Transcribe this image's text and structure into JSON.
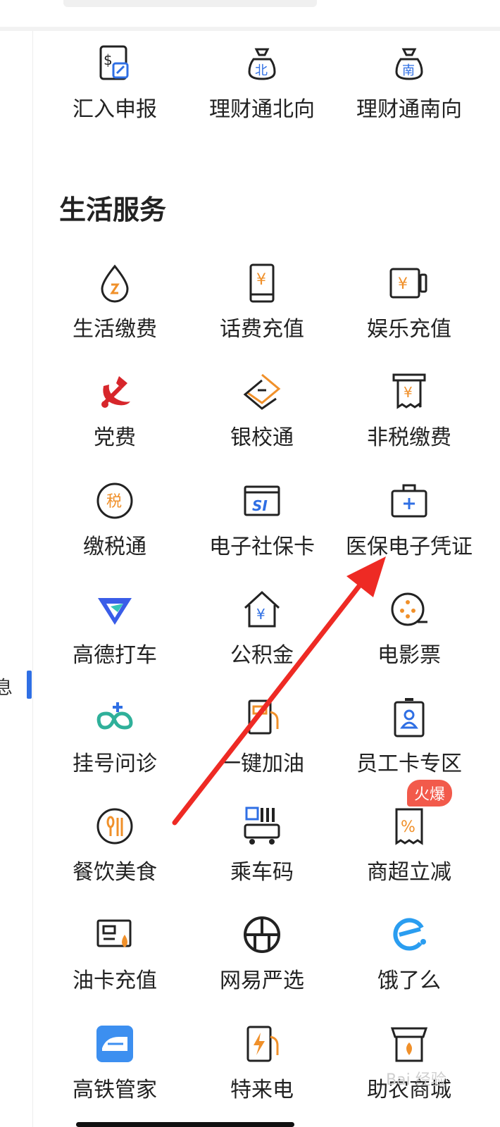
{
  "finance": {
    "items": [
      {
        "label": "汇入申报",
        "icon": "remittance-declare-icon"
      },
      {
        "label": "理财通北向",
        "icon": "northbound-moneybag-icon",
        "glyph": "北"
      },
      {
        "label": "理财通南向",
        "icon": "southbound-moneybag-icon",
        "glyph": "南"
      }
    ]
  },
  "sidebar": {
    "active_label": "息"
  },
  "life_services": {
    "title": "生活服务",
    "items": [
      {
        "label": "生活缴费",
        "icon": "utility-drop-icon"
      },
      {
        "label": "话费充值",
        "icon": "phone-topup-icon",
        "glyph": "¥"
      },
      {
        "label": "娱乐充值",
        "icon": "entertainment-topup-icon",
        "glyph": "¥"
      },
      {
        "label": "党费",
        "icon": "party-emblem-icon"
      },
      {
        "label": "银校通",
        "icon": "bank-school-icon"
      },
      {
        "label": "非税缴费",
        "icon": "non-tax-receipt-icon",
        "glyph": "¥"
      },
      {
        "label": "缴税通",
        "icon": "tax-icon",
        "glyph": "税"
      },
      {
        "label": "电子社保卡",
        "icon": "social-security-card-icon",
        "glyph": "SI"
      },
      {
        "label": "医保电子凭证",
        "icon": "medical-kit-icon"
      },
      {
        "label": "高德打车",
        "icon": "amap-taxi-icon"
      },
      {
        "label": "公积金",
        "icon": "housing-fund-icon",
        "glyph": "¥"
      },
      {
        "label": "电影票",
        "icon": "movie-reel-icon"
      },
      {
        "label": "挂号问诊",
        "icon": "hospital-registration-icon"
      },
      {
        "label": "一键加油",
        "icon": "fuel-pump-icon"
      },
      {
        "label": "员工卡专区",
        "icon": "employee-badge-icon"
      },
      {
        "label": "餐饮美食",
        "icon": "dining-icon"
      },
      {
        "label": "乘车码",
        "icon": "bus-qr-icon"
      },
      {
        "label": "商超立减",
        "icon": "discount-receipt-icon",
        "glyph": "%"
      },
      {
        "label": "油卡充值",
        "icon": "fuel-card-icon"
      },
      {
        "label": "网易严选",
        "icon": "netease-yanxuan-icon"
      },
      {
        "label": "饿了么",
        "icon": "eleme-icon"
      },
      {
        "label": "高铁管家",
        "icon": "high-speed-rail-icon"
      },
      {
        "label": "特来电",
        "icon": "ev-charging-icon"
      },
      {
        "label": "助农商城",
        "icon": "farm-shop-icon"
      }
    ],
    "hot_badge": "火爆"
  },
  "watermark": "Bai 经验",
  "colors": {
    "accent": "#2f6fe4",
    "icon_orange": "#f0902a",
    "badge_red": "#f25a4b",
    "arrow_red": "#ee2a24",
    "party_red": "#d7262b"
  }
}
